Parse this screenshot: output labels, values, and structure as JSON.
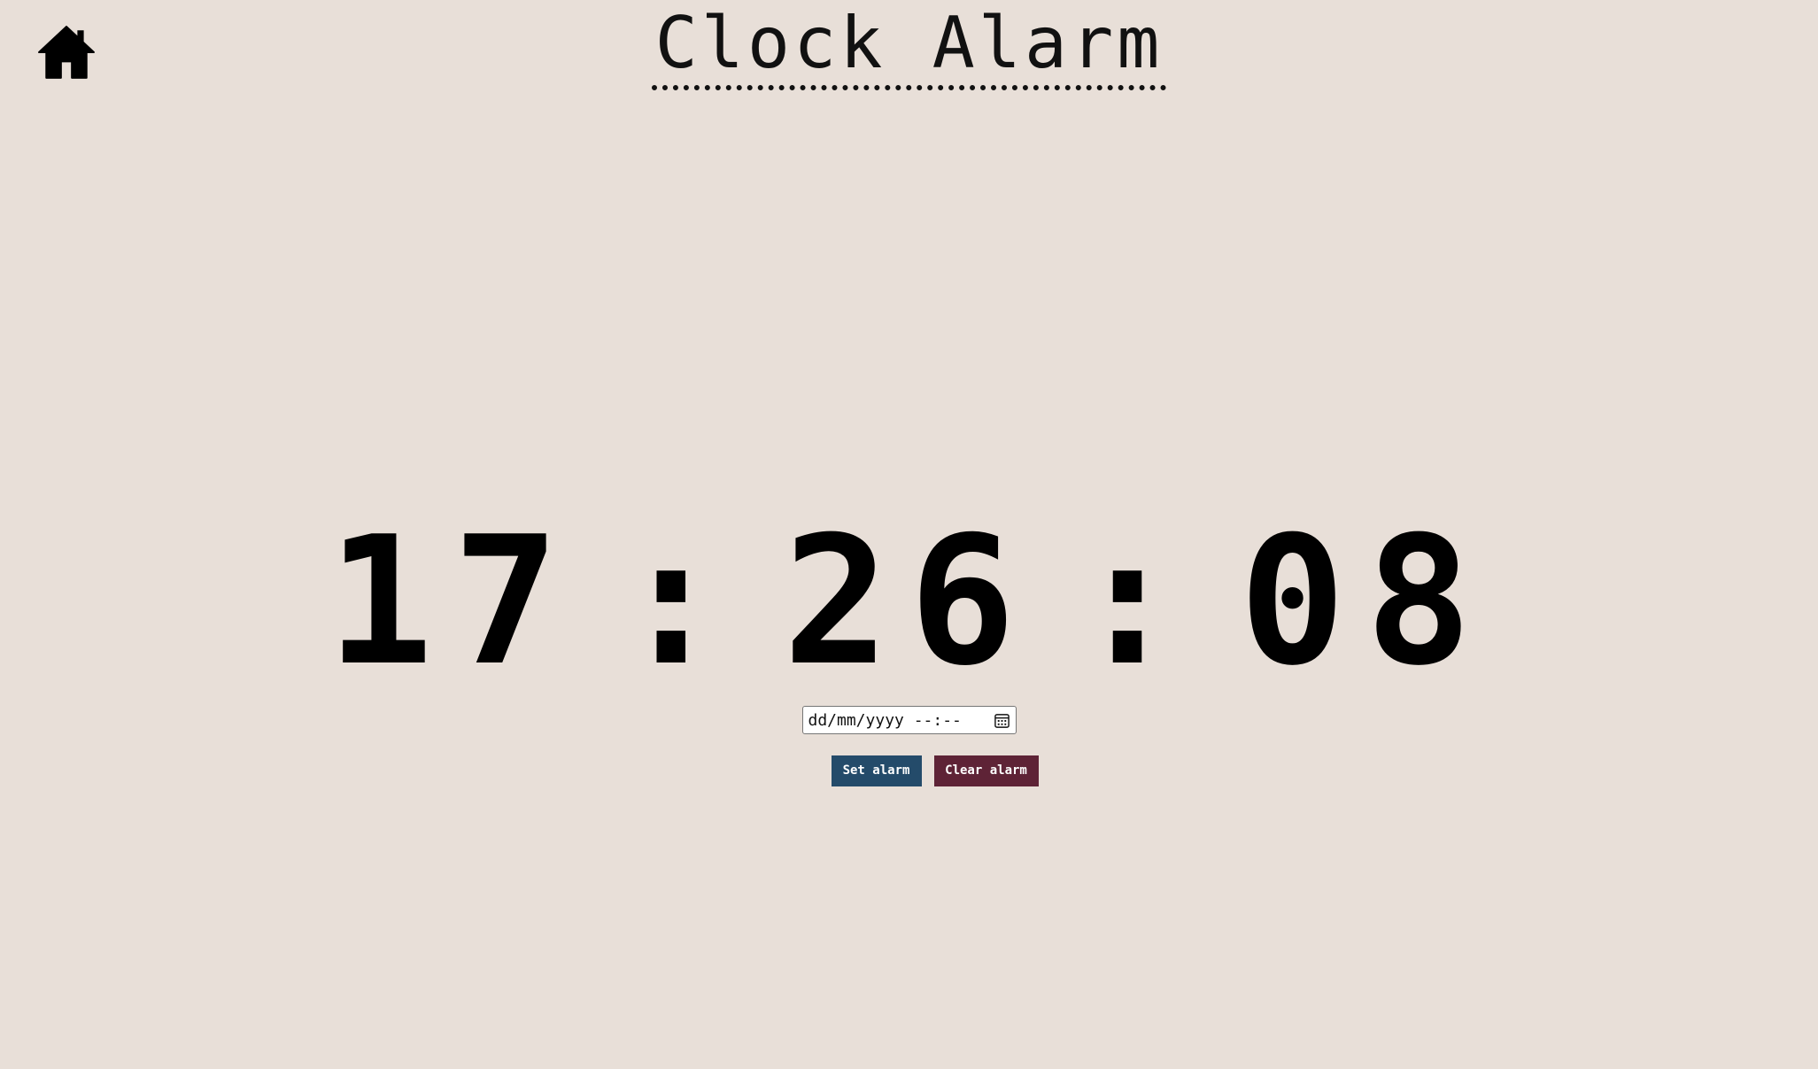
{
  "header": {
    "title": "Clock Alarm",
    "home_icon": "home-icon"
  },
  "clock": {
    "hours": "17",
    "minutes": "26",
    "seconds": "08",
    "separator": ":"
  },
  "alarm": {
    "datetime_placeholder": "dd/mm/yyyy --:--",
    "calendar_icon": "calendar-icon",
    "set_label": "Set alarm",
    "clear_label": "Clear alarm"
  },
  "colors": {
    "background": "#e8dfd8",
    "set_button": "#244b6a",
    "clear_button": "#5e2336"
  }
}
